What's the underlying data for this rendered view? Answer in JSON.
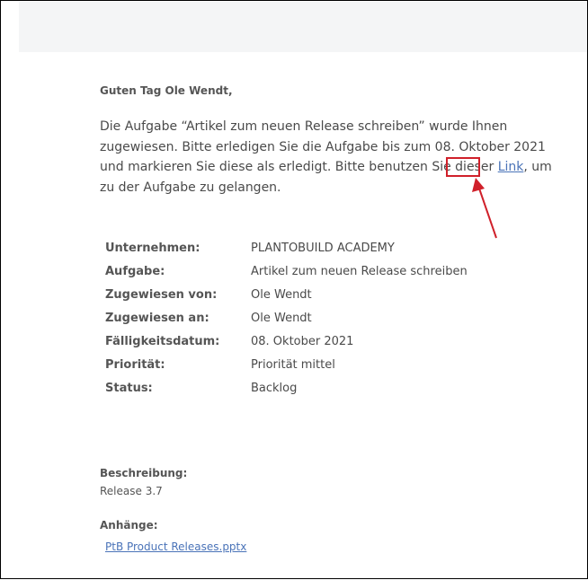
{
  "email": {
    "greeting": "Guten Tag Ole Wendt,",
    "intro_part1": "Die Aufgabe “Artikel zum neuen Release schreiben” wurde Ihnen zugewiesen. Bitte erledigen Sie die Aufgabe bis zum 08. Oktober 2021 und markieren Sie diese als erledigt. Bitte benutzen Sie dieser ",
    "link_text": "Link",
    "intro_part2": ", um zu der Aufgabe zu gelangen.",
    "details": [
      {
        "label": "Unternehmen:",
        "value": "PLANTOBUILD ACADEMY"
      },
      {
        "label": "Aufgabe:",
        "value": "Artikel zum neuen Release schreiben"
      },
      {
        "label": "Zugewiesen von:",
        "value": "Ole Wendt"
      },
      {
        "label": "Zugewiesen an:",
        "value": "Ole Wendt"
      },
      {
        "label": "Fälligkeitsdatum:",
        "value": "08. Oktober 2021"
      },
      {
        "label": "Priorität:",
        "value": "Priorität mittel"
      },
      {
        "label": "Status:",
        "value": "Backlog"
      }
    ],
    "description_label": "Beschreibung:",
    "description_value": "Release 3.7",
    "attachments_label": "Anhänge:",
    "attachment_link": "PtB Product Releases.pptx"
  },
  "annotation": {
    "highlight_color": "#d0202a"
  }
}
